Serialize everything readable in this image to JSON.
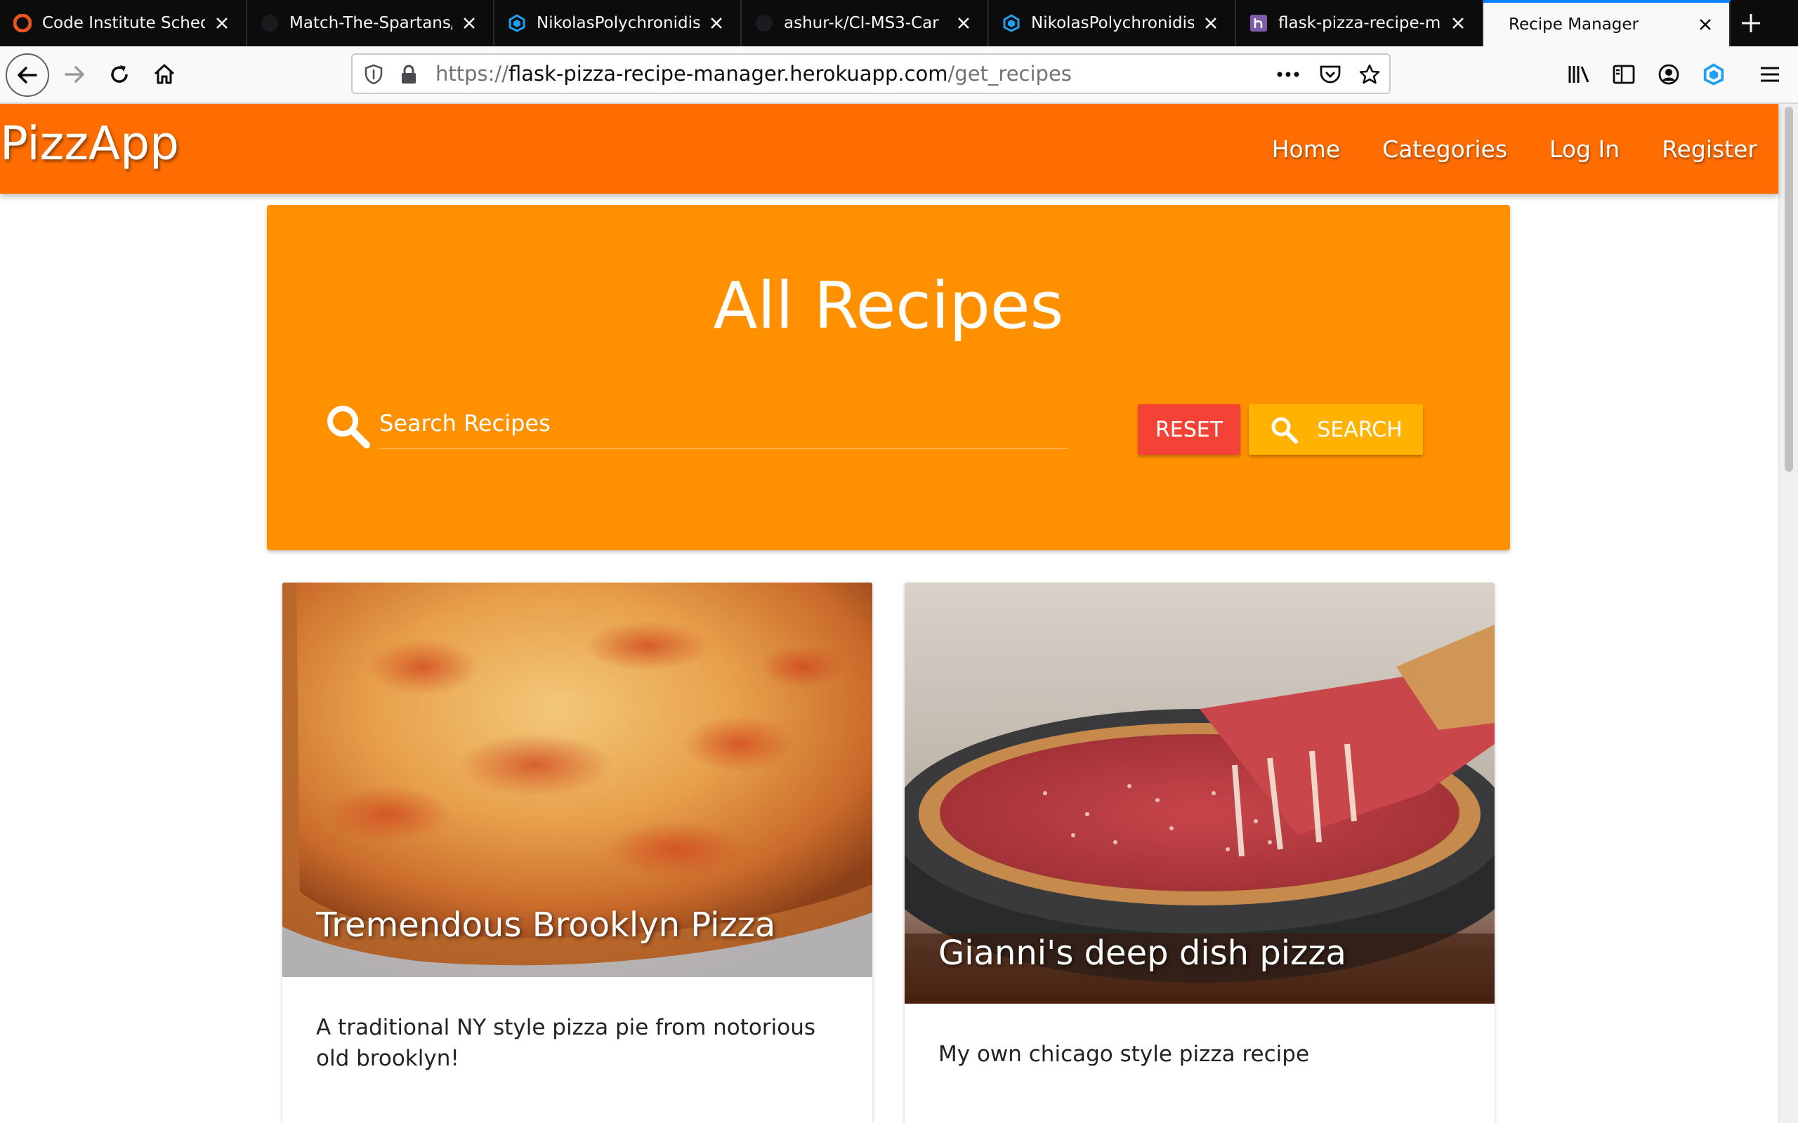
{
  "browser": {
    "tabs": [
      {
        "title": "Code Institute Schedu",
        "icon": "code-institute-icon"
      },
      {
        "title": "Match-The-Spartans/",
        "icon": "github-icon"
      },
      {
        "title": "NikolasPolychronidis/",
        "icon": "gitpod-icon"
      },
      {
        "title": "ashur-k/CI-MS3-Car",
        "icon": "github-icon"
      },
      {
        "title": "NikolasPolychronidis/",
        "icon": "gitpod-icon"
      },
      {
        "title": "flask-pizza-recipe-m",
        "icon": "heroku-icon"
      },
      {
        "title": "Recipe Manager",
        "icon": ""
      }
    ],
    "url_scheme": "https://",
    "url_host": "flask-pizza-recipe-manager.herokuapp.com",
    "url_path": "/get_recipes"
  },
  "site": {
    "brand": "PizzApp",
    "nav": [
      "Home",
      "Categories",
      "Log In",
      "Register"
    ],
    "accent_color": "#ff6d00"
  },
  "hero": {
    "title": "All Recipes",
    "search_placeholder": "Search Recipes",
    "reset_label": "RESET",
    "search_label": "SEARCH"
  },
  "recipes": [
    {
      "name": "Tremendous Brooklyn Pizza",
      "description": "A traditional NY style pizza pie from notorious old brooklyn!"
    },
    {
      "name": "Gianni's deep dish pizza",
      "description": "My own chicago style pizza recipe"
    }
  ]
}
